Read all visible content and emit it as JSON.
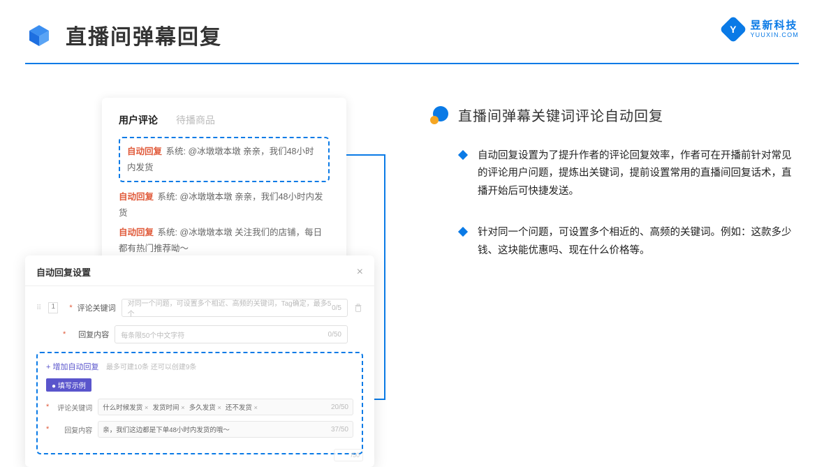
{
  "header": {
    "title": "直播间弹幕回复"
  },
  "brand": {
    "name": "昱新科技",
    "url": "YUUXIN.COM",
    "mark": "Y"
  },
  "comments": {
    "tabs": {
      "active": "用户评论",
      "inactive": "待播商品"
    },
    "highlighted": {
      "tag": "自动回复",
      "text": "系统: @冰墩墩本墩 亲亲，我们48小时内发货"
    },
    "line2": {
      "tag": "自动回复",
      "text": "系统: @冰墩墩本墩 亲亲，我们48小时内发货"
    },
    "line3": {
      "tag": "自动回复",
      "text": "系统: @冰墩墩本墩 关注我们的店铺，每日都有热门推荐呦～"
    }
  },
  "dialog": {
    "title": "自动回复设置",
    "index": "1",
    "field_keyword_label": "评论关键词",
    "field_keyword_placeholder": "对同一个问题，可设置多个相近、高频的关键词，Tag确定，最多5个",
    "field_keyword_counter": "0/5",
    "field_content_label": "回复内容",
    "field_content_placeholder": "每条限50个中文字符",
    "field_content_counter": "0/50",
    "add_link": "+ 增加自动回复",
    "add_hint": "最多可建10条 还可以创建9条",
    "example_badge": "● 填写示例",
    "ex_keyword_label": "评论关键词",
    "ex_tags": [
      "什么时候发货",
      "发货时间",
      "多久发货",
      "还不发货"
    ],
    "ex_keyword_counter": "20/50",
    "ex_content_label": "回复内容",
    "ex_content_text": "亲，我们这边都是下单48小时内发货的哦～",
    "ex_content_counter": "37/50",
    "stub_counter": "/50"
  },
  "right": {
    "title": "直播间弹幕关键词评论自动回复",
    "bullet1": "自动回复设置为了提升作者的评论回复效率，作者可在开播前针对常见的评论用户问题，提炼出关键词，提前设置常用的直播间回复话术，直播开始后可快捷发送。",
    "bullet2": "针对同一个问题，可设置多个相近的、高频的关键词。例如：这款多少钱、这块能优惠吗、现在什么价格等。"
  }
}
